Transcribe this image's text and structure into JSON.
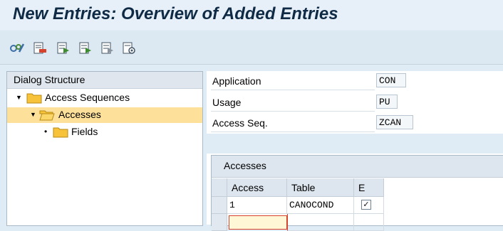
{
  "title": "New Entries: Overview of Added Entries",
  "toolbar": {
    "icons": [
      "display-change-icon",
      "delete-row-icon",
      "select-all-icon",
      "select-block-icon",
      "deselect-all-icon",
      "configure-icon"
    ]
  },
  "dialog_structure": {
    "header": "Dialog Structure",
    "items": [
      {
        "label": "Access Sequences",
        "expander": "▼",
        "selected": false
      },
      {
        "label": "Accesses",
        "expander": "▼",
        "selected": true
      },
      {
        "label": "Fields",
        "expander": "•",
        "selected": false
      }
    ]
  },
  "fields": {
    "application": {
      "label": "Application",
      "value": "CON"
    },
    "usage": {
      "label": "Usage",
      "value": "PU"
    },
    "access_seq": {
      "label": "Access Seq.",
      "value": "ZCAN"
    }
  },
  "accesses_table": {
    "title": "Accesses",
    "columns": [
      "Access",
      "Table",
      "E"
    ],
    "rows": [
      {
        "access": "1",
        "table": "CANOCOND",
        "exclusive": true
      }
    ]
  },
  "colors": {
    "selected_row": "#fde19b",
    "folder": "#f6c33a",
    "title": "#0f2a45"
  }
}
